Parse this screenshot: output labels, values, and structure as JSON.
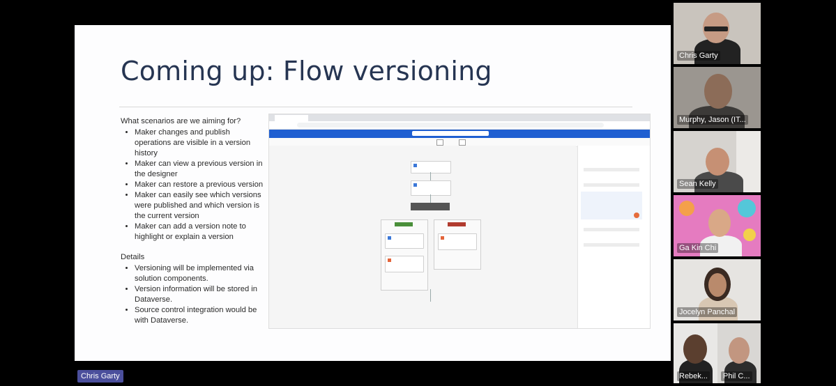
{
  "slide": {
    "title": "Coming up: Flow versioning",
    "section1": "What scenarios are we aiming for?",
    "bullets1": [
      "Maker changes and publish operations are visible in a version history",
      "Maker can view a previous version in the designer",
      "Maker can restore a previous version",
      "Maker can easily see which versions were published and which version is the current version",
      "Maker can add a version note to highlight or explain a version"
    ],
    "section2": "Details",
    "bullets2": [
      "Versioning will be implemented via solution components.",
      "Version information will be stored in Dataverse.",
      "Source control integration would be with Dataverse."
    ]
  },
  "participants": [
    {
      "name": "Chris Garty",
      "bg": "#c9c4bd"
    },
    {
      "name": "Murphy, Jason (IT...",
      "bg": "#9b9690"
    },
    {
      "name": "Sean Kelly",
      "bg": "#d6d3cf"
    },
    {
      "name": "Ga Kin Chi",
      "bg": "#e57bc0"
    },
    {
      "name": "Jocelyn Panchal",
      "bg": "#e6e4e1"
    },
    {
      "name": "Rebek...",
      "bg": "#e9e8e6"
    },
    {
      "name": "Phil C...",
      "bg": "#d9d7d4"
    }
  ],
  "presenter": {
    "name": "Chris Garty"
  },
  "colors": {
    "title": "#263552",
    "presenter_tag": "#4b4f9c",
    "app_bar": "#1f5fd1"
  }
}
